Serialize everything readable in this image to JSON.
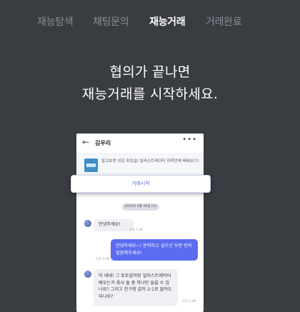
{
  "tabs": [
    "재능탐색",
    "채팅문의",
    "재능거래",
    "거래완료"
  ],
  "active_tab": "재능거래",
  "headline": {
    "line1": "협의가 끝나면",
    "line2": "재능거래를 시작하세요."
  },
  "phone": {
    "back_glyph": "←",
    "user_name": "김우리",
    "more_glyph": "•••",
    "product_text": "알고보면 쉬운 포토샵/ 일러스트레이터 하루만에 배워보기!",
    "start_button_label": "거래시작",
    "date_label": "2020년 0월 26일 (수)",
    "messages": [
      {
        "from": "them",
        "text": "안녕하세요!",
        "time": "오후 1:40"
      },
      {
        "from": "me",
        "text": "안녕하세요~! 문의하고 싶으신 부분 먼저 말씀해주세요!",
        "time": "오후 1:40"
      },
      {
        "from": "them",
        "text": "아 네네! 그 포토샵이랑 일러스트레이터 배우는거 혹시 둘 중 하나만 들을 수 있나요? 그리고 친구랑 같이 2:1로 들어도되나요?",
        "time": "오후 1:40"
      }
    ]
  },
  "colors": {
    "background": "#393c41",
    "accent": "#5b6cf0",
    "tab_inactive": "#8b8f96"
  }
}
